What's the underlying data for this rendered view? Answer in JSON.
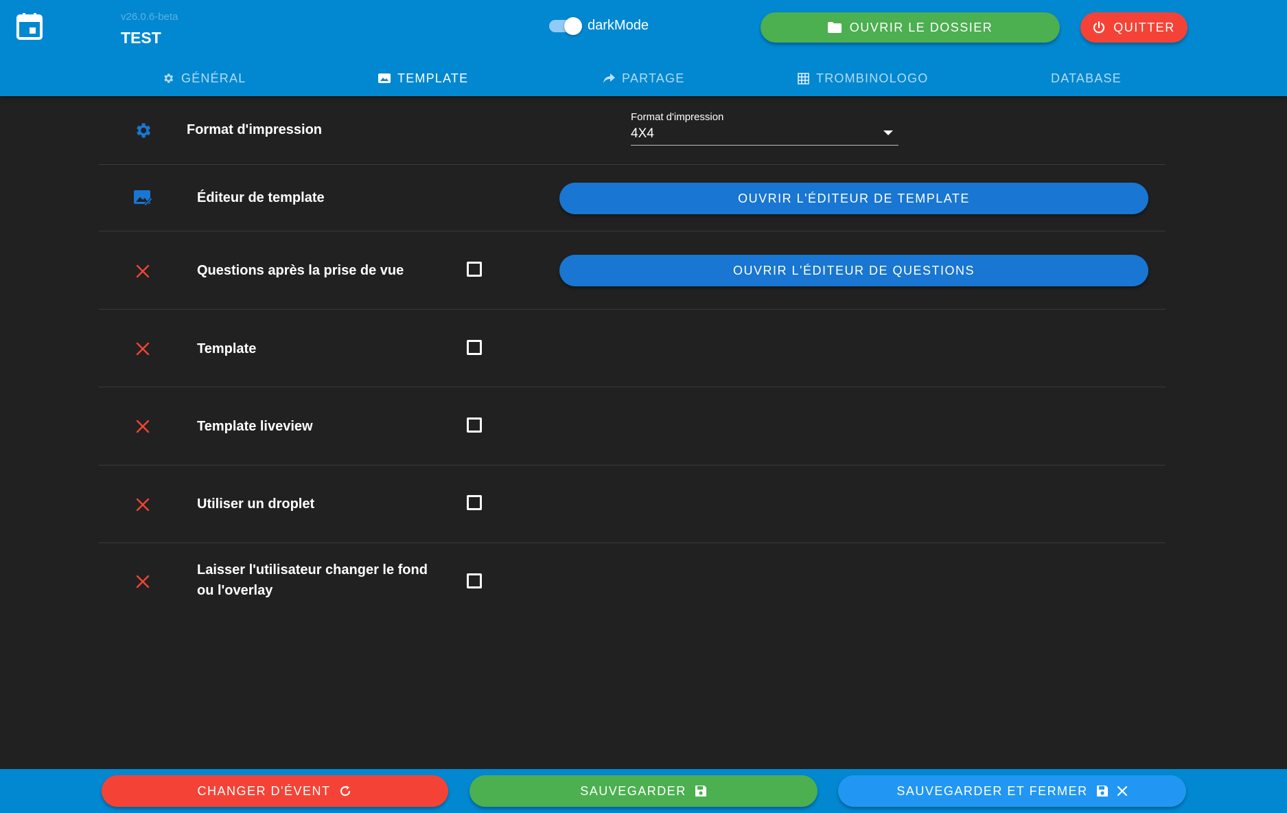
{
  "header": {
    "version": "v26.0.6-beta",
    "event_name": "TEST",
    "dark_mode_label": "darkMode",
    "dark_mode_on": true,
    "open_folder_label": "OUVRIR LE DOSSIER",
    "quit_label": "QUITTER"
  },
  "tabs": [
    {
      "label": "GÉNÉRAL",
      "icon": "gear-icon",
      "active": false
    },
    {
      "label": "TEMPLATE",
      "icon": "image-icon",
      "active": true
    },
    {
      "label": "PARTAGE",
      "icon": "share-icon",
      "active": false
    },
    {
      "label": "TROMBINOLOGO",
      "icon": "grid-icon",
      "active": false
    },
    {
      "label": "DATABASE",
      "icon": "",
      "active": false
    }
  ],
  "settings": {
    "print_format": {
      "label": "Format d'impression",
      "select_caption": "Format d'impression",
      "select_value": "4X4"
    },
    "template_editor": {
      "label": "Éditeur de template",
      "button_label": "OUVRIR L'ÉDITEUR DE TEMPLATE"
    },
    "questions": {
      "label": "Questions après la prise de vue",
      "checked": false,
      "button_label": "OUVRIR L'ÉDITEUR DE QUESTIONS"
    },
    "template": {
      "label": "Template",
      "checked": false
    },
    "template_liveview": {
      "label": "Template liveview",
      "checked": false
    },
    "droplet": {
      "label": "Utiliser un droplet",
      "checked": false
    },
    "change_background": {
      "label_line1": "Laisser l'utilisateur changer le fond",
      "label_line2": "ou l'overlay",
      "checked": false
    }
  },
  "footer": {
    "change_event_label": "CHANGER D'ÉVENT",
    "save_label": "SAUVEGARDER",
    "save_close_label": "SAUVEGARDER ET FERMER"
  },
  "colors": {
    "header_bg": "#0288d1",
    "content_bg": "#212121",
    "accent_blue": "#1976d2",
    "success_green": "#4caf50",
    "danger_red": "#f44336",
    "x_icon_red": "#f44336"
  }
}
